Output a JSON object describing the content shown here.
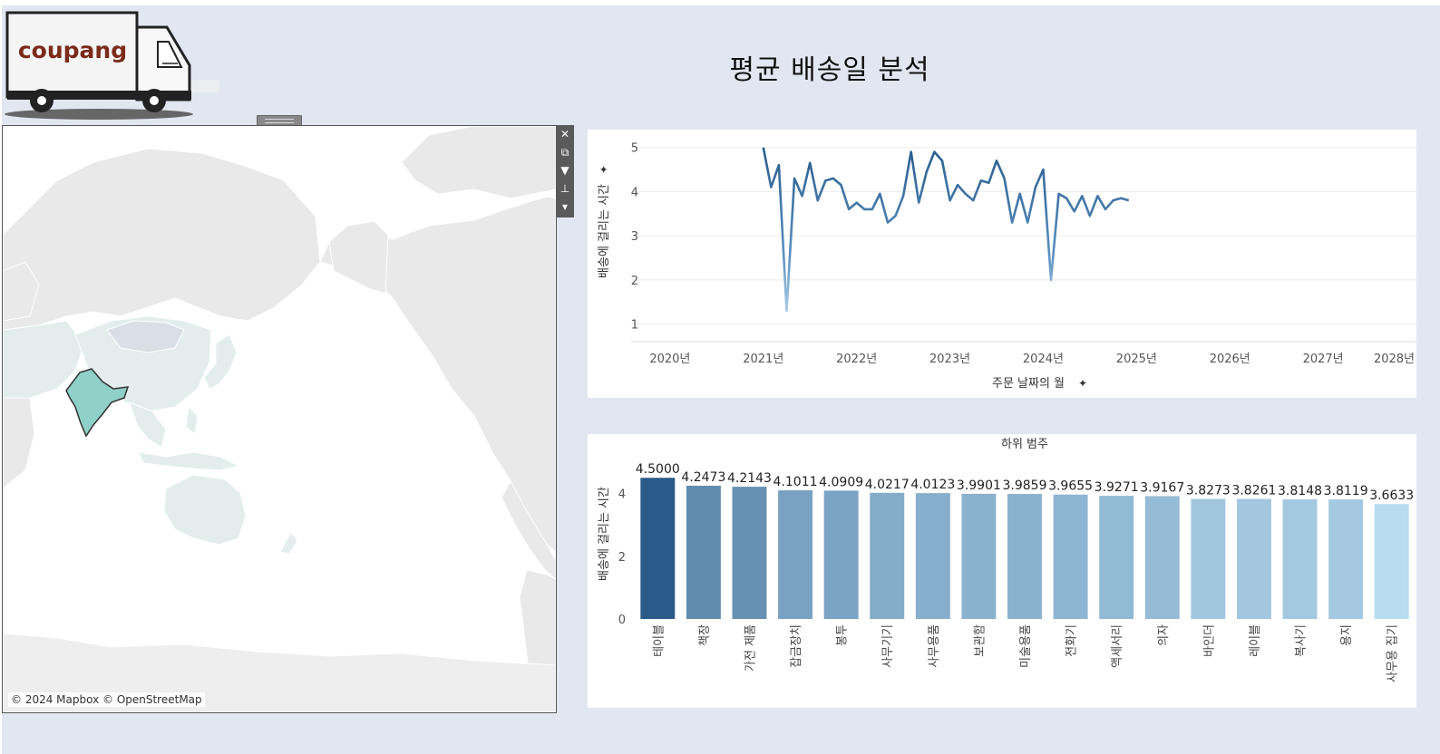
{
  "dashboard": {
    "title": "평균 배송일 분석",
    "logo_text": "coupang"
  },
  "map": {
    "attribution": "© 2024 Mapbox © OpenStreetMap",
    "highlight_color": "#8fd0c8"
  },
  "toolbar": {
    "icons": [
      "close-icon",
      "popout-icon",
      "filter-icon",
      "pin-icon",
      "more-icon"
    ]
  },
  "colors": {
    "line_dark": "#2b5e8f",
    "line_light": "#a9cde8",
    "bar_dark": "#2b5a88",
    "bar_light": "#b8dcf0"
  },
  "chart_data": [
    {
      "type": "line",
      "title": "",
      "xlabel": "주문 날짜의 월",
      "ylabel": "배송에 걸리는 시간",
      "x_ticks": [
        "2020년",
        "2021년",
        "2022년",
        "2023년",
        "2024년",
        "2025년",
        "2026년",
        "2027년",
        "2028년"
      ],
      "y_ticks": [
        "1",
        "2",
        "3",
        "4",
        "5"
      ],
      "xlim": [
        "2019-08",
        "2028-01"
      ],
      "ylim": [
        0.6,
        5.2
      ],
      "grid": true,
      "x": [
        "2021-01",
        "2021-02",
        "2021-03",
        "2021-04",
        "2021-05",
        "2021-06",
        "2021-07",
        "2021-08",
        "2021-09",
        "2021-10",
        "2021-11",
        "2021-12",
        "2022-01",
        "2022-02",
        "2022-03",
        "2022-04",
        "2022-05",
        "2022-06",
        "2022-07",
        "2022-08",
        "2022-09",
        "2022-10",
        "2022-11",
        "2022-12",
        "2023-01",
        "2023-02",
        "2023-03",
        "2023-04",
        "2023-05",
        "2023-06",
        "2023-07",
        "2023-08",
        "2023-09",
        "2023-10",
        "2023-11",
        "2023-12",
        "2024-01",
        "2024-02",
        "2024-03",
        "2024-04",
        "2024-05",
        "2024-06",
        "2024-07",
        "2024-08",
        "2024-09",
        "2024-10",
        "2024-11",
        "2024-12"
      ],
      "values": [
        5.0,
        4.1,
        4.6,
        1.3,
        4.3,
        3.9,
        4.65,
        3.8,
        4.25,
        4.3,
        4.15,
        3.6,
        3.75,
        3.6,
        3.6,
        3.95,
        3.3,
        3.45,
        3.9,
        4.9,
        3.75,
        4.45,
        4.9,
        4.7,
        3.8,
        4.15,
        3.95,
        3.8,
        4.25,
        4.2,
        4.7,
        4.3,
        3.3,
        3.95,
        3.3,
        4.1,
        4.5,
        2.0,
        3.95,
        3.85,
        3.55,
        3.9,
        3.45,
        3.9,
        3.6,
        3.8,
        3.85,
        3.8
      ]
    },
    {
      "type": "bar",
      "title": "하위 범주",
      "xlabel": "",
      "ylabel": "배송에 걸리는 시간",
      "y_ticks": [
        "0",
        "2",
        "4"
      ],
      "ylim": [
        0,
        5.2
      ],
      "categories": [
        "테이블",
        "책장",
        "가전 제품",
        "잡금장치",
        "봉투",
        "사무기기",
        "사무용품",
        "보관함",
        "미술용품",
        "전화기",
        "액세서리",
        "의자",
        "바인더",
        "레이블",
        "복사기",
        "용지",
        "사무용 집기"
      ],
      "values": [
        4.5,
        4.2473,
        4.2143,
        4.1011,
        4.0909,
        4.0217,
        4.0123,
        3.9901,
        3.9859,
        3.9655,
        3.9271,
        3.9167,
        3.8273,
        3.8261,
        3.8148,
        3.8119,
        3.6633
      ],
      "labels": [
        "4.5000",
        "4.2473",
        "4.2143",
        "4.1011",
        "4.0909",
        "4.0217",
        "4.0123",
        "3.9901",
        "3.9859",
        "3.9655",
        "3.9271",
        "3.9167",
        "3.8273",
        "3.8261",
        "3.8148",
        "3.8119",
        "3.6633"
      ]
    }
  ]
}
